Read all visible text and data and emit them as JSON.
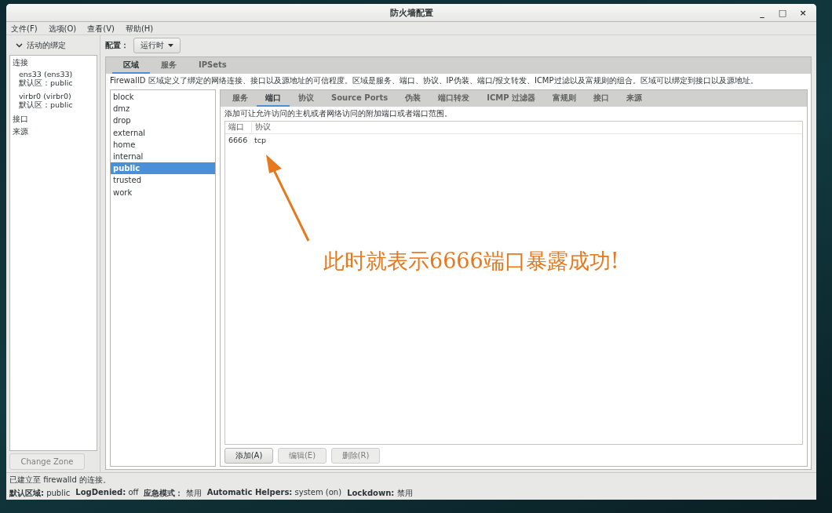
{
  "window": {
    "title": "防火墙配置",
    "controls": [
      "_",
      "□",
      "×"
    ]
  },
  "menu": [
    "文件(F)",
    "选项(O)",
    "查看(V)",
    "帮助(H)"
  ],
  "bindings": {
    "header": "活动的绑定",
    "expanded": true,
    "items": [
      {
        "kind": "group",
        "label": "连接"
      },
      {
        "kind": "entry",
        "name": "ens33 (ens33)",
        "zone": "默认区：public"
      },
      {
        "kind": "entry",
        "name": "virbr0 (virbr0)",
        "zone": "默认区：public"
      },
      {
        "kind": "group",
        "label": "接口"
      },
      {
        "kind": "group",
        "label": "来源"
      }
    ],
    "button": {
      "label": "Change Zone",
      "disabled": true
    }
  },
  "config": {
    "label": "配置：",
    "value": "运行时"
  },
  "tabs": [
    {
      "label": "区域",
      "selected": true
    },
    {
      "label": "服务",
      "selected": false
    },
    {
      "label": "IPSets",
      "selected": false
    }
  ],
  "zone_description": "FirewallD 区域定义了绑定的网络连接、接口以及源地址的可信程度。区域是服务、端口、协议、IP伪装、端口/报文转发、ICMP过滤以及富规则的组合。区域可以绑定到接口以及源地址。",
  "zones": [
    {
      "label": "block",
      "selected": false
    },
    {
      "label": "dmz",
      "selected": false
    },
    {
      "label": "drop",
      "selected": false
    },
    {
      "label": "external",
      "selected": false
    },
    {
      "label": "home",
      "selected": false
    },
    {
      "label": "internal",
      "selected": false
    },
    {
      "label": "public",
      "selected": true
    },
    {
      "label": "trusted",
      "selected": false
    },
    {
      "label": "work",
      "selected": false
    }
  ],
  "zone_tabs": [
    {
      "label": "服务",
      "selected": false
    },
    {
      "label": "端口",
      "selected": true
    },
    {
      "label": "协议",
      "selected": false
    },
    {
      "label": "Source Ports",
      "selected": false
    },
    {
      "label": "伪装",
      "selected": false
    },
    {
      "label": "端口转发",
      "selected": false
    },
    {
      "label": "ICMP 过滤器",
      "selected": false
    },
    {
      "label": "富规则",
      "selected": false
    },
    {
      "label": "接口",
      "selected": false
    },
    {
      "label": "来源",
      "selected": false
    }
  ],
  "ports_description": "添加可让允许访问的主机或者网络访问的附加端口或者端口范围。",
  "table": {
    "columns": [
      "端口",
      "协议"
    ],
    "rows": [
      [
        "6666",
        "tcp"
      ]
    ]
  },
  "buttons": [
    {
      "label": "添加(A)",
      "disabled": false
    },
    {
      "label": "编辑(E)",
      "disabled": true
    },
    {
      "label": "删除(R)",
      "disabled": true
    }
  ],
  "annotation": "此时就表示6666端口暴露成功!",
  "status": {
    "message": "已建立至  firewalld 的连接。",
    "items": [
      "**默认区域:** public",
      "**LogDenied:** off",
      "**应急模式：** 禁用",
      "**Automatic Helpers:** system (on)",
      "**Lockdown:** 禁用"
    ]
  }
}
